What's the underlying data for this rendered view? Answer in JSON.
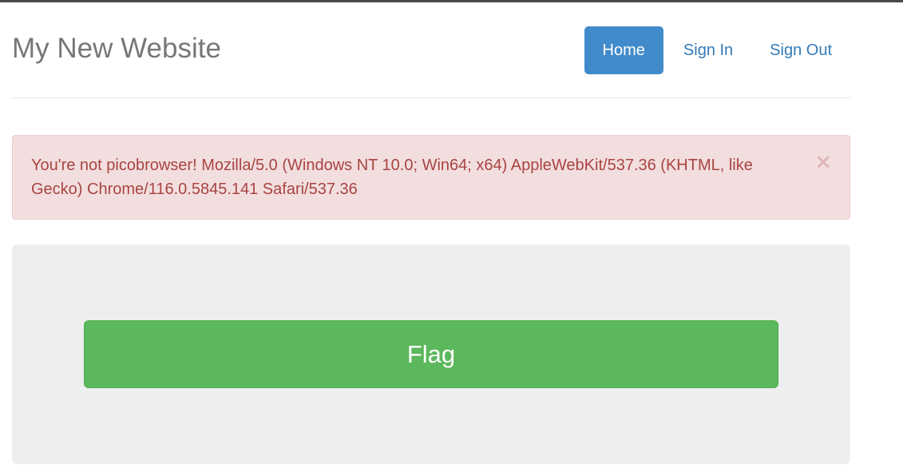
{
  "header": {
    "site_title": "My New Website",
    "nav": [
      {
        "label": "Home",
        "active": true
      },
      {
        "label": "Sign In",
        "active": false
      },
      {
        "label": "Sign Out",
        "active": false
      }
    ]
  },
  "alert": {
    "message": "You're not picobrowser! Mozilla/5.0 (Windows NT 10.0; Win64; x64) AppleWebKit/537.36 (KHTML, like Gecko) Chrome/116.0.5845.141 Safari/537.36",
    "close_symbol": "×"
  },
  "main": {
    "flag_button_label": "Flag"
  },
  "colors": {
    "primary": "#428bca",
    "link": "#337ab7",
    "danger_bg": "#f2dede",
    "danger_text": "#a94442",
    "success": "#5cb85c",
    "jumbotron_bg": "#eeeeee"
  }
}
